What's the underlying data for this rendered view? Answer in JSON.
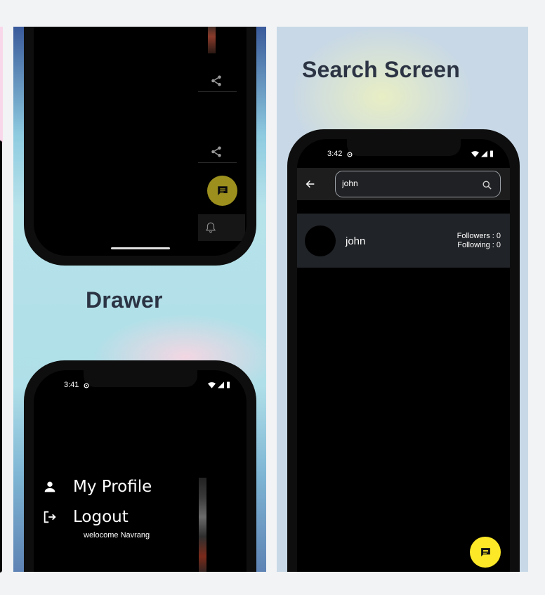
{
  "drawer_panel": {
    "title": "Drawer",
    "top_phone": {
      "actions": [
        {
          "icon": "share-icon"
        },
        {
          "icon": "share-icon"
        }
      ],
      "chat_fab_icon": "chat-icon",
      "notification_icon": "bell-icon"
    },
    "bottom_phone": {
      "status_time": "3:41",
      "menu": [
        {
          "label": "My Profile",
          "icon": "person-icon"
        },
        {
          "label": "Logout",
          "icon": "logout-icon"
        }
      ],
      "welcome_text": "welocome Navrang"
    }
  },
  "search_panel": {
    "title": "Search Screen",
    "phone": {
      "status_time": "3:42",
      "search": {
        "value": "john",
        "placeholder": ""
      },
      "results": [
        {
          "name": "john",
          "followers": "Followers : 0",
          "following": "Following : 0"
        }
      ],
      "fab_icon": "chat-icon",
      "bottom_nav": [
        {
          "icon": "home-icon"
        },
        {
          "icon": "search-icon"
        },
        {
          "icon": "notification-icon"
        }
      ]
    }
  },
  "colors": {
    "fab_yellow": "#fde828",
    "fab_olive": "#d8c72a",
    "card_bg": "#202327",
    "title_text": "#2c3444"
  }
}
